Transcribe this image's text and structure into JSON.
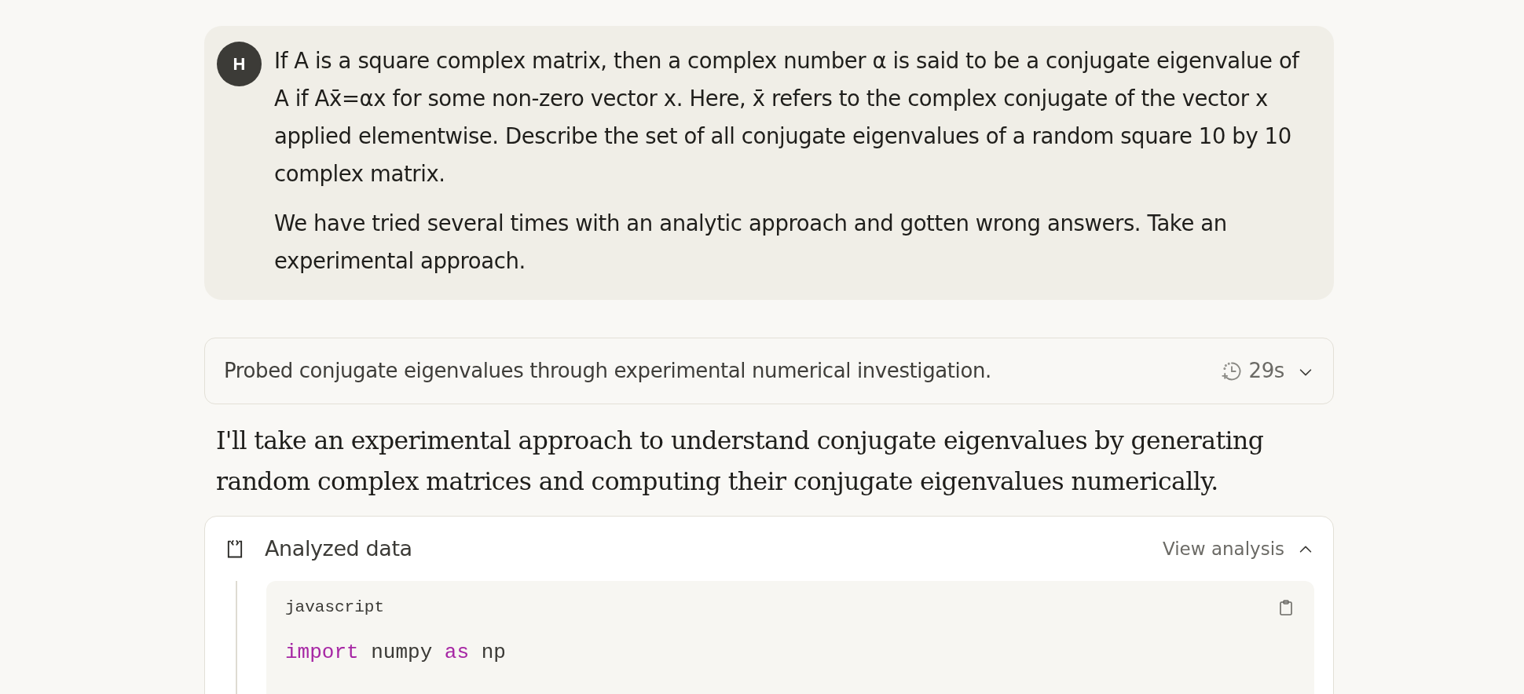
{
  "user_message": {
    "avatar": "H",
    "paragraphs": [
      "If A is a square complex matrix, then a complex number α is said to be a conjugate eigenvalue of A if Ax̄=αx for some non-zero vector x. Here, x̄ refers to the complex conjugate of the vector x applied elementwise. Describe the set of all conjugate eigenvalues of a random square 10 by 10 complex matrix.",
      "We have tried several times with an analytic approach and gotten wrong answers. Take an experimental approach."
    ]
  },
  "thinking": {
    "summary": "Probed conjugate eigenvalues through experimental numerical investigation.",
    "duration": "29s",
    "expanded": false
  },
  "response": {
    "text": "I'll take an experimental approach to understand conjugate eigenvalues by generating random complex matrices and computing their conjugate eigenvalues numerically."
  },
  "analysis": {
    "title": "Analyzed data",
    "action": "View analysis",
    "expanded": true,
    "code": {
      "language": "javascript",
      "lines": [
        [
          {
            "text": "import",
            "kind": "keyword"
          },
          {
            "text": " numpy ",
            "kind": "plain"
          },
          {
            "text": "as",
            "kind": "keyword"
          },
          {
            "text": " np",
            "kind": "plain"
          }
        ]
      ]
    }
  }
}
